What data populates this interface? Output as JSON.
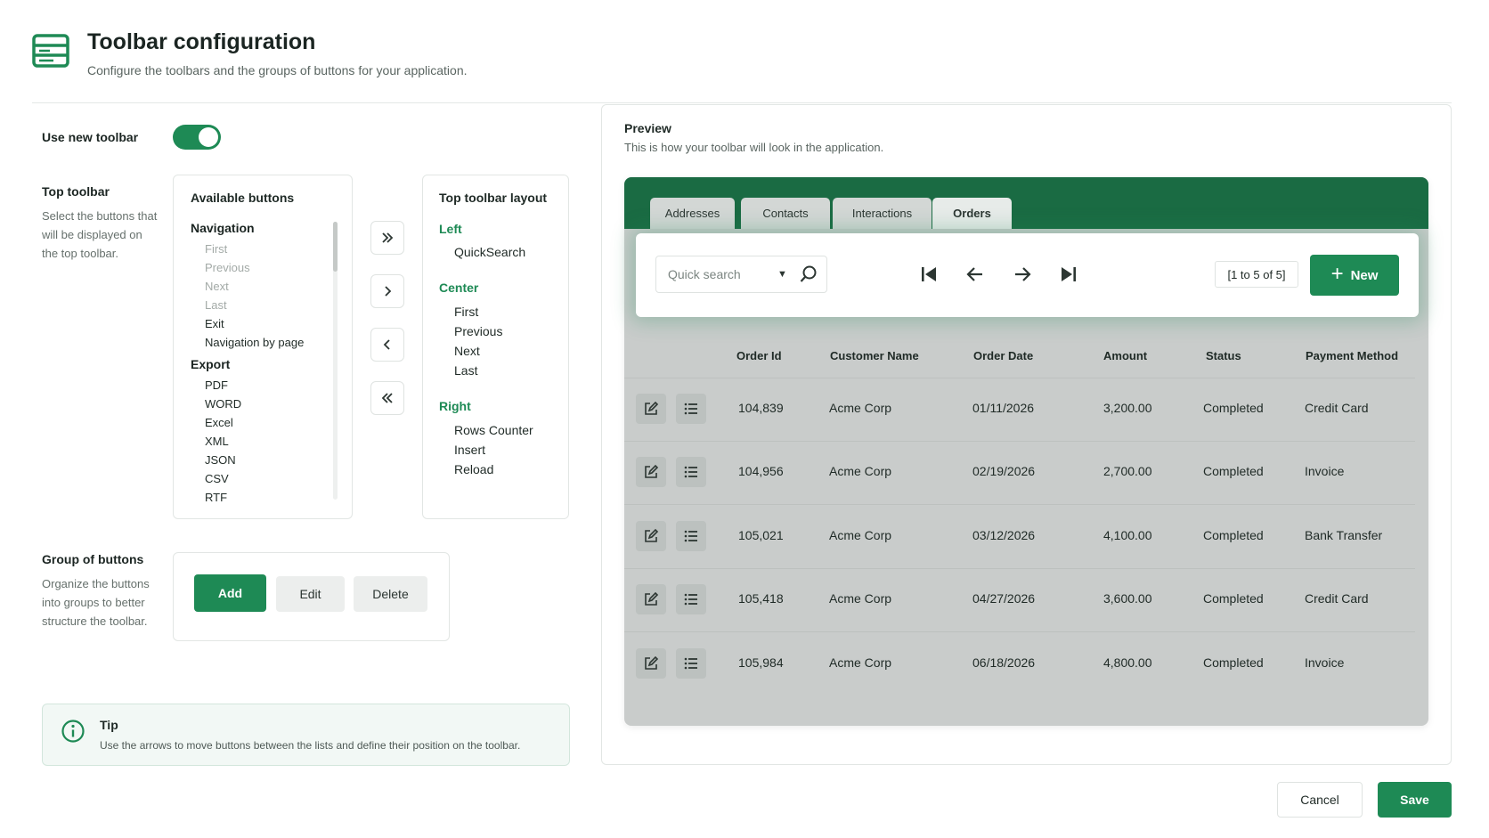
{
  "header": {
    "title": "Toolbar configuration",
    "subtitle": "Configure the toolbars and the groups of buttons for your application."
  },
  "settings": {
    "use_new_toolbar_label": "Use new toolbar",
    "use_new_toolbar_on": true,
    "top_toolbar_label": "Top toolbar",
    "top_toolbar_desc": [
      "Select the buttons that",
      "will be displayed on",
      "the top toolbar."
    ],
    "group_label": "Group of buttons",
    "group_desc": [
      "Organize the buttons",
      "into groups to better",
      "structure the toolbar."
    ]
  },
  "available": {
    "title": "Available buttons",
    "navigation_head": "Navigation",
    "navigation_items": [
      "First",
      "Previous",
      "Next",
      "Last",
      "Exit",
      "Navigation by page"
    ],
    "export_head": "Export",
    "export_items": [
      "PDF",
      "WORD",
      "Excel",
      "XML",
      "JSON",
      "CSV",
      "RTF"
    ]
  },
  "layout": {
    "title": "Top toolbar layout",
    "left_head": "Left",
    "left_items": [
      "QuickSearch"
    ],
    "center_head": "Center",
    "center_items": [
      "First",
      "Previous",
      "Next",
      "Last"
    ],
    "right_head": "Right",
    "right_items": [
      "Rows Counter",
      "Insert",
      "Reload"
    ]
  },
  "group_buttons": {
    "add": "Add",
    "edit": "Edit",
    "delete": "Delete"
  },
  "tip": {
    "title": "Tip",
    "text": "Use the arrows to move buttons between the lists and define their position on the toolbar."
  },
  "preview": {
    "title": "Preview",
    "subtitle": "This is how your toolbar will look in the application.",
    "tabs": [
      "Addresses",
      "Contacts",
      "Interactions",
      "Orders"
    ],
    "active_tab": "Orders",
    "search_placeholder": "Quick search",
    "counter": "[1 to 5 of 5]",
    "new_label": "New",
    "columns": [
      "Order Id",
      "Customer Name",
      "Order Date",
      "Amount",
      "Status",
      "Payment Method"
    ],
    "rows": [
      [
        "104,839",
        "Acme Corp",
        "01/11/2026",
        "3,200.00",
        "Completed",
        "Credit Card"
      ],
      [
        "104,956",
        "Acme Corp",
        "02/19/2026",
        "2,700.00",
        "Completed",
        "Invoice"
      ],
      [
        "105,021",
        "Acme Corp",
        "03/12/2026",
        "4,100.00",
        "Completed",
        "Bank Transfer"
      ],
      [
        "105,418",
        "Acme Corp",
        "04/27/2026",
        "3,600.00",
        "Completed",
        "Credit Card"
      ],
      [
        "105,984",
        "Acme Corp",
        "06/18/2026",
        "4,800.00",
        "Completed",
        "Invoice"
      ]
    ]
  },
  "footer": {
    "cancel": "Cancel",
    "save": "Save"
  },
  "colors": {
    "accent": "#1e8a55",
    "band": "#1a6b43"
  }
}
